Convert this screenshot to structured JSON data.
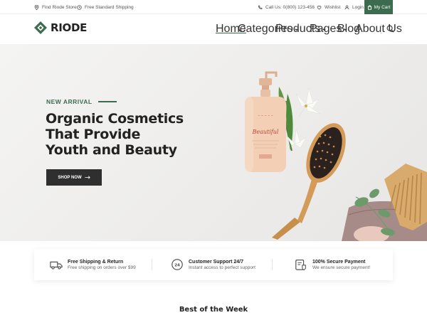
{
  "topbar": {
    "store_label": "Find Riode Store",
    "shipping_label": "Free Standard Shipping",
    "call_label": "Call Us: 0(800) 123-456",
    "wishlist_label": "Wishlist",
    "login_label": "Login",
    "cart_label": "My Cart"
  },
  "header": {
    "logo_text": "RIODE",
    "nav": [
      {
        "label": "Home"
      },
      {
        "label": "Categories"
      },
      {
        "label": "Products"
      },
      {
        "label": "Pages"
      },
      {
        "label": "Blog"
      },
      {
        "label": "About Us"
      }
    ]
  },
  "hero": {
    "tag": "NEW ARRIVAL",
    "title_line1": "Organic Cosmetics",
    "title_line2": "That Provide",
    "title_line3": "Youth and Beauty",
    "button_label": "SHOP NOW",
    "bottle_script": "Beautiful"
  },
  "features": [
    {
      "title": "Free Shipping & Return",
      "subtitle": "Free shipping on orders over $99"
    },
    {
      "title": "Customer Support 24/7",
      "subtitle": "Instant access to perfect support"
    },
    {
      "title": "100% Secure Payment",
      "subtitle": "We ensure secure payment!"
    }
  ],
  "section": {
    "title": "Best of the Week"
  },
  "colors": {
    "accent": "#3d6b4f",
    "dark_button": "#2f2f2f",
    "hero_bg": "#eeedeb"
  }
}
